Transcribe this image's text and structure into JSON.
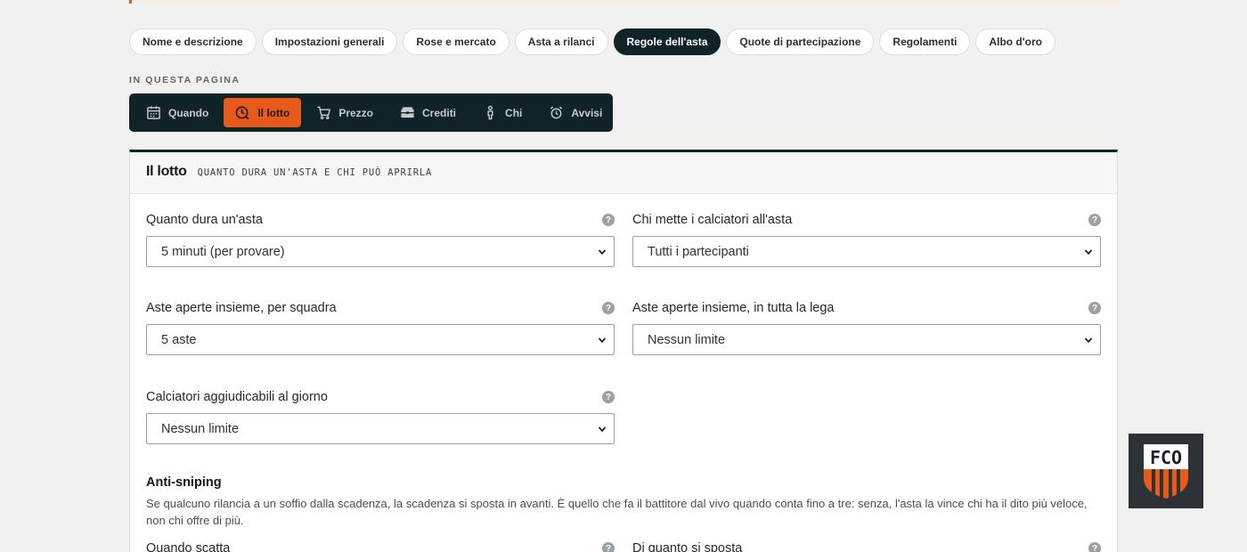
{
  "tabs": [
    {
      "label": "Nome e descrizione",
      "active": false
    },
    {
      "label": "Impostazioni generali",
      "active": false
    },
    {
      "label": "Rose e mercato",
      "active": false
    },
    {
      "label": "Asta a rilanci",
      "active": false
    },
    {
      "label": "Regole dell'asta",
      "active": true
    },
    {
      "label": "Quote di partecipazione",
      "active": false
    },
    {
      "label": "Regolamenti",
      "active": false
    },
    {
      "label": "Albo d'oro",
      "active": false
    }
  ],
  "on_page_label": "IN QUESTA PAGINA",
  "anchors": [
    {
      "label": "Quando",
      "icon": "calendar-icon",
      "active": false
    },
    {
      "label": "Il lotto",
      "icon": "clock-icon",
      "active": true
    },
    {
      "label": "Prezzo",
      "icon": "cart-icon",
      "active": false
    },
    {
      "label": "Crediti",
      "icon": "wallet-icon",
      "active": false
    },
    {
      "label": "Chi",
      "icon": "person-icon",
      "active": false
    },
    {
      "label": "Avvisi",
      "icon": "alarm-icon",
      "active": false
    }
  ],
  "section": {
    "title": "Il lotto",
    "subtitle": "QUANTO DURA UN'ASTA E CHI PUÒ APRIRLA"
  },
  "fields": {
    "durata": {
      "label": "Quanto dura un'asta",
      "value": "5 minuti (per provare)"
    },
    "chi_mette": {
      "label": "Chi mette i calciatori all'asta",
      "value": "Tutti i partecipanti"
    },
    "aste_squadra": {
      "label": "Aste aperte insieme, per squadra",
      "value": "5 aste"
    },
    "aste_lega": {
      "label": "Aste aperte insieme, in tutta la lega",
      "value": "Nessun limite"
    },
    "giornaliero": {
      "label": "Calciatori aggiudicabili al giorno",
      "value": "Nessun limite"
    },
    "quando_scatta": {
      "label": "Quando scatta"
    },
    "di_quanto": {
      "label": "Di quanto si sposta"
    }
  },
  "help_glyph": "?",
  "anti_sniping": {
    "title": "Anti-sniping",
    "description": "Se qualcuno rilancia a un soffio dalla scadenza, la scadenza si sposta in avanti. È quello che fa il battitore dal vivo quando conta fino a tre: senza, l'asta la vince chi ha il dito più veloce, non chi offre di più."
  },
  "logo": {
    "text": "FCO"
  },
  "colors": {
    "accent": "#e85a1a",
    "dark": "#0f2328",
    "background": "#f1f2f0"
  }
}
